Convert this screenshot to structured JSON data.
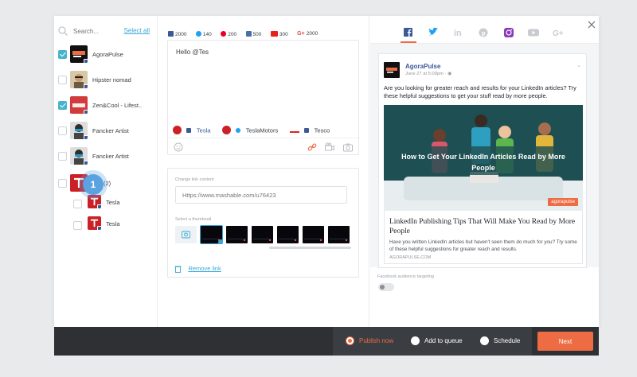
{
  "left": {
    "search_placeholder": "Search...",
    "select_all": "Select all",
    "accounts": [
      {
        "name": "AgoraPulse",
        "checked": true
      },
      {
        "name": "Hipster nomad",
        "checked": false
      },
      {
        "name": "Zen&Cool - Lifest..",
        "checked": true
      },
      {
        "name": "Fancker Artist",
        "checked": false
      },
      {
        "name": "Fancker Artist",
        "checked": false
      },
      {
        "name": "(2)",
        "checked": false
      },
      {
        "name": "Tesla",
        "checked": false
      },
      {
        "name": "Tesla",
        "checked": false
      }
    ],
    "step_badge": "1"
  },
  "composer": {
    "counts": [
      {
        "network": "facebook",
        "value": "2000",
        "color": "#3b5998"
      },
      {
        "network": "twitter",
        "value": "140",
        "color": "#1da1f2"
      },
      {
        "network": "pinterest",
        "value": "200",
        "color": "#e60023"
      },
      {
        "network": "instagram",
        "value": "500",
        "color": "#4a6fa5"
      },
      {
        "network": "youtube",
        "value": "300",
        "color": "#e62117"
      },
      {
        "network": "google-plus",
        "value": "2000",
        "color": "#dd4b39"
      }
    ],
    "message": "Hello @Tes",
    "mentions": [
      {
        "label": "Tesla",
        "network": "facebook",
        "color": "#3b5998"
      },
      {
        "label": "TeslaMotors",
        "network": "twitter",
        "color": "#3a3d42"
      },
      {
        "label": "Tesco",
        "network": "facebook",
        "color": "#3a3d42"
      }
    ]
  },
  "link": {
    "change_label": "Change link content",
    "url_placeholder": "Https://www.mashable.com/u76423",
    "thumb_label": "Select a thumbnail",
    "remove_label": "Remove link"
  },
  "preview": {
    "page_name": "AgoraPulse",
    "date": "June 27 at 5:00pm · ",
    "text": "Are you looking for greater reach and results for your LinkedIn articles? Try these helpful suggestions to get your stuff read by more people.",
    "image_title": "How to Get Your LinkedIn Articles Read by More People",
    "image_logo": "agorapulse",
    "link_title": "LinkedIn Publishing Tips That Will Make You Read by More People",
    "link_desc": "Have you written LinkedIn articles but haven't seen them do much for you? Try some of these helpful suggestions for greater reach and results.",
    "link_domain": "AGORAPULSE.COM",
    "audience_label": "Facebook audience targeting"
  },
  "footer": {
    "publish_now": "Publish now",
    "add_to_queue": "Add to queue",
    "schedule": "Schedule",
    "next": "Next"
  },
  "colors": {
    "accent": "#ed6c44",
    "link": "#3aa7d8",
    "facebook": "#3b5998"
  }
}
